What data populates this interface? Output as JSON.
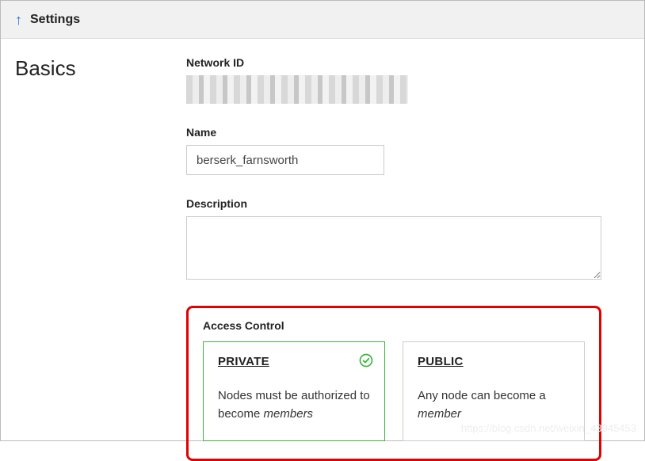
{
  "header": {
    "title": "Settings"
  },
  "section": {
    "title": "Basics"
  },
  "fields": {
    "network_id_label": "Network ID",
    "name_label": "Name",
    "name_value": "berserk_farnsworth",
    "description_label": "Description",
    "description_value": ""
  },
  "access": {
    "label": "Access Control",
    "private": {
      "title": "PRIVATE",
      "desc_prefix": "Nodes must be authorized to become ",
      "desc_em": "members"
    },
    "public": {
      "title": "PUBLIC",
      "desc_prefix": "Any node can become a ",
      "desc_em": "member"
    }
  },
  "watermark": "https://blog.csdn.net/weixin_43945453"
}
